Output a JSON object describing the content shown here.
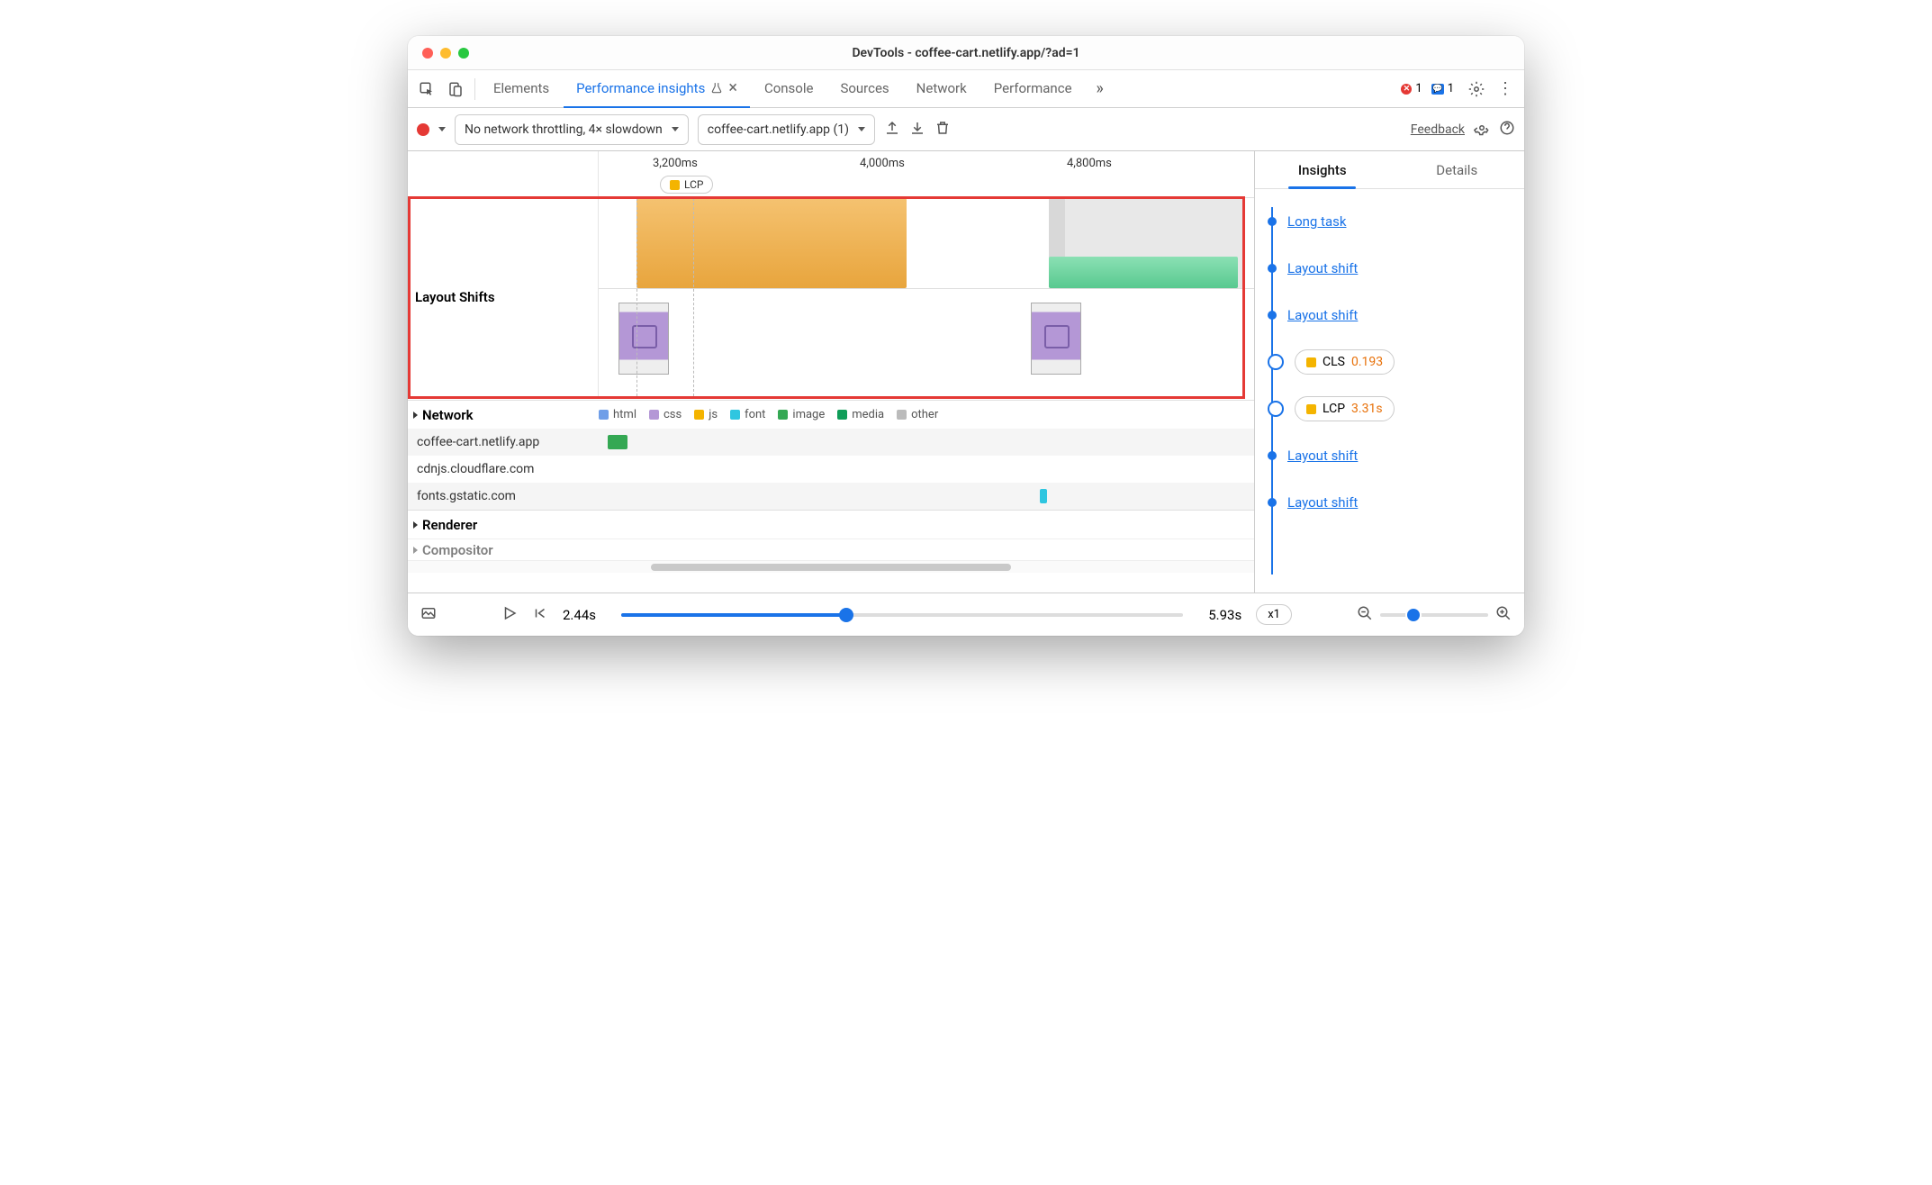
{
  "window": {
    "title": "DevTools - coffee-cart.netlify.app/?ad=1"
  },
  "tabs": {
    "items": [
      "Elements",
      "Performance insights",
      "Console",
      "Sources",
      "Network",
      "Performance"
    ],
    "close_x": "×",
    "errors": "1",
    "issues": "1"
  },
  "subbar": {
    "throttle": "No network throttling, 4× slowdown",
    "recording": "coffee-cart.netlify.app (1)",
    "feedback": "Feedback"
  },
  "ticks": [
    "3,200ms",
    "4,000ms",
    "4,800ms"
  ],
  "lcp_pill": "LCP",
  "track_label": "Layout Shifts",
  "network": {
    "label": "Network",
    "legend": [
      "html",
      "css",
      "js",
      "font",
      "image",
      "media",
      "other"
    ],
    "hosts": [
      "coffee-cart.netlify.app",
      "cdnjs.cloudflare.com",
      "fonts.gstatic.com"
    ]
  },
  "renderer": "Renderer",
  "compositor": "Compositor",
  "footer": {
    "start": "2.44s",
    "end": "5.93s",
    "zoom": "x1"
  },
  "insights": {
    "tabs": [
      "Insights",
      "Details"
    ],
    "items": [
      {
        "type": "link",
        "label": "Long task"
      },
      {
        "type": "link",
        "label": "Layout shift"
      },
      {
        "type": "link",
        "label": "Layout shift"
      },
      {
        "type": "pill",
        "label": "CLS",
        "value": "0.193",
        "color": "#f4b400"
      },
      {
        "type": "pill",
        "label": "LCP",
        "value": "3.31s",
        "color": "#f4b400"
      },
      {
        "type": "link",
        "label": "Layout shift"
      },
      {
        "type": "link",
        "label": "Layout shift"
      }
    ]
  },
  "colors": {
    "html": "#6f9ee8",
    "css": "#b497d6",
    "js": "#f4b400",
    "font": "#2fc6e0",
    "image": "#34a853",
    "media": "#0f9d58",
    "other": "#bbb",
    "orange": "#f0a840",
    "green": "#58c98f"
  }
}
